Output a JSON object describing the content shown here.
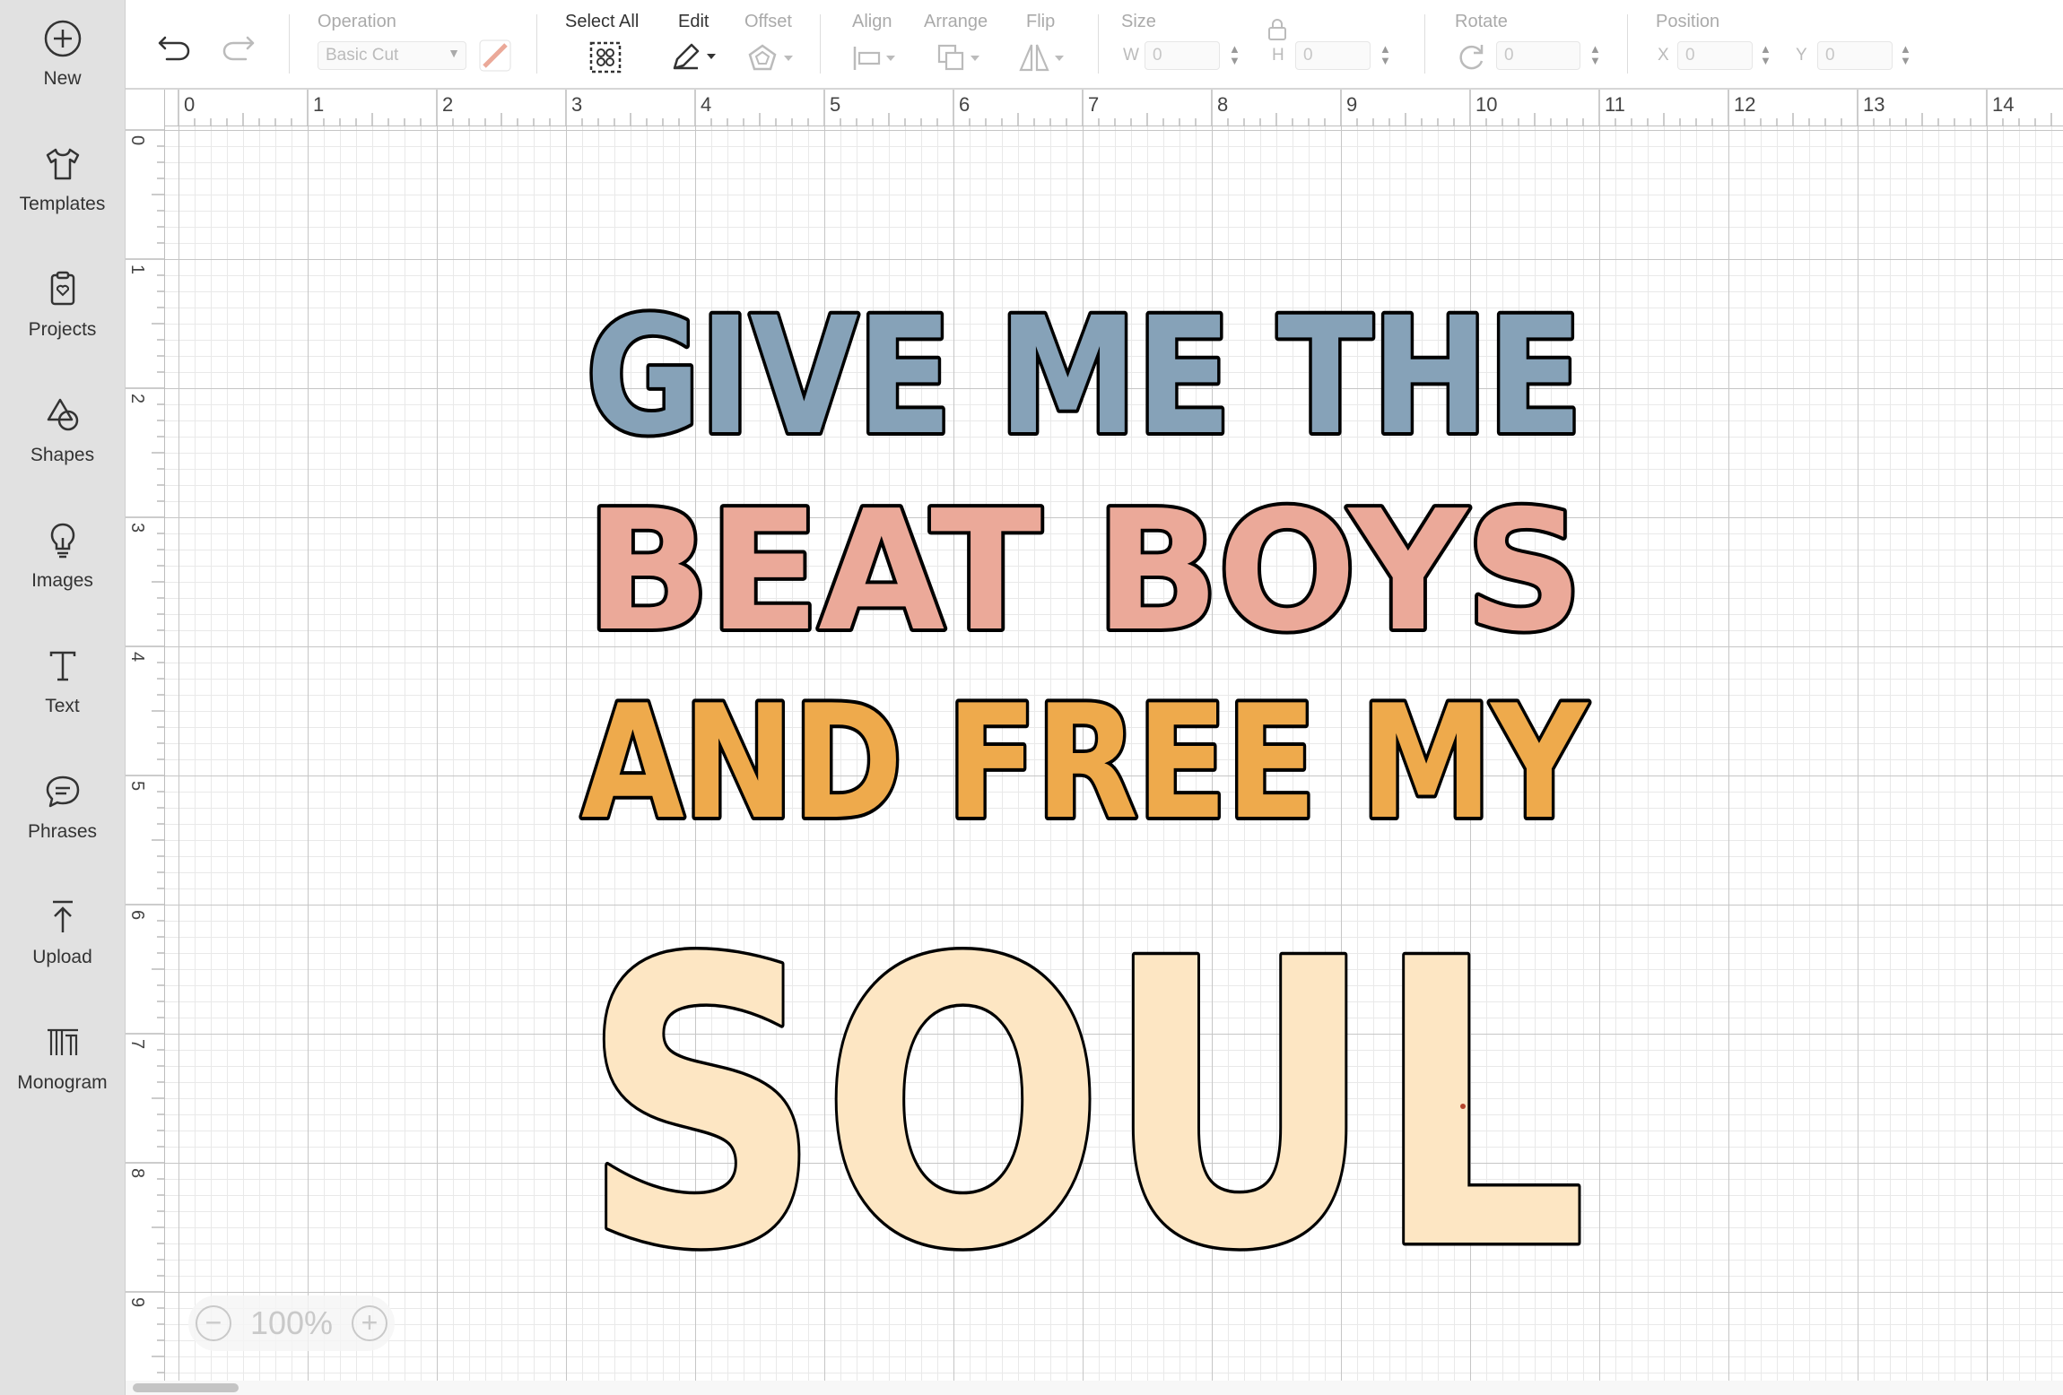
{
  "sidebar": {
    "items": [
      {
        "label": "New",
        "icon": "plus-circle-icon"
      },
      {
        "label": "Templates",
        "icon": "tshirt-icon"
      },
      {
        "label": "Projects",
        "icon": "clipboard-heart-icon"
      },
      {
        "label": "Shapes",
        "icon": "shapes-icon"
      },
      {
        "label": "Images",
        "icon": "lightbulb-icon"
      },
      {
        "label": "Text",
        "icon": "text-t-icon"
      },
      {
        "label": "Phrases",
        "icon": "speech-bubble-icon"
      },
      {
        "label": "Upload",
        "icon": "upload-arrow-icon"
      },
      {
        "label": "Monogram",
        "icon": "monogram-icon"
      }
    ]
  },
  "toolbar": {
    "operation_label": "Operation",
    "operation_value": "Basic Cut",
    "select_all_label": "Select All",
    "edit_label": "Edit",
    "offset_label": "Offset",
    "align_label": "Align",
    "arrange_label": "Arrange",
    "flip_label": "Flip",
    "size_label": "Size",
    "w_prefix": "W",
    "h_prefix": "H",
    "w_value": "0",
    "h_value": "0",
    "rotate_label": "Rotate",
    "rotate_value": "0",
    "position_label": "Position",
    "x_prefix": "X",
    "y_prefix": "Y",
    "x_value": "0",
    "y_value": "0"
  },
  "ruler": {
    "horizontal": [
      "0",
      "1",
      "2",
      "3",
      "4",
      "5",
      "6",
      "7",
      "8",
      "9",
      "10",
      "11",
      "12",
      "13",
      "14"
    ],
    "vertical": [
      "0",
      "1",
      "2",
      "3",
      "4",
      "5",
      "6",
      "7",
      "8",
      "9"
    ]
  },
  "design": {
    "lines": [
      {
        "text": "GIVE ME THE",
        "color": "#86a2b8"
      },
      {
        "text": "BEAT BOYS",
        "color": "#eba999"
      },
      {
        "text": "AND FREE MY",
        "color": "#eeaa4c"
      },
      {
        "text": "SOUL",
        "color": "#fde6c3"
      }
    ]
  },
  "zoom": {
    "value": "100%"
  }
}
